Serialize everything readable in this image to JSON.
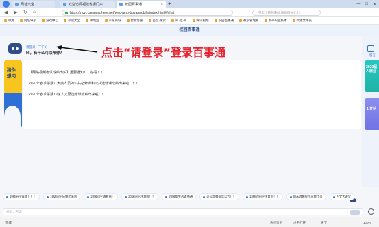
{
  "browser": {
    "tabs": [
      {
        "label": "网址大全",
        "active": false
      },
      {
        "label": "欢迎访问福建省振门户",
        "active": false
      },
      {
        "label": "校园百事通",
        "active": true
      }
    ],
    "url": "https://ncvt.campusphere.net/wec-amp-boya/mobile/index.html#/chat",
    "search_placeholder": "英工出纸越来(化国语精分化出)",
    "bookmarks": [
      "收藏",
      "网址导航",
      "游戏中心",
      "小说大全",
      "邮电监",
      "京东商城",
      "智能客服",
      "百度·搜索",
      "阿·拉·萌",
      "腾讯视频",
      "校园百事通",
      "教学管理系",
      "南平职业技术",
      "新建文件夹"
    ]
  },
  "page": {
    "title": "校园百事通",
    "greeting_link": "请登录，下午好",
    "greeting_question": "Hi，有什么可以帮你？",
    "annotation": "点击“请登录”登录百事通",
    "left_card_title": "猜你想问",
    "notices": [
      "【网络视频考试成绩出炉】重要通知！！必看！！",
      "2020年春季学期八大类人员的公共必修课和公共选修课成绩出来啦！！！",
      "2020年春季学期19级人文限选修课成绩出来啦！！"
    ],
    "right_card_1": "2020届人就业",
    "right_card_2": "1 开始",
    "right_sidebar_label": "留言",
    "chips": [
      "19级开学成绩！！！",
      "19级同学成绩出来啦",
      "20级同学请看看！",
      "20级同学注意啦！！",
      "20级新生选课事通",
      "这些温馨提示公告！！",
      "18级的同学注意啦！！",
      "期末温馨提示成绩出来",
      "人文大讲堂"
    ],
    "input_placeholder": "相问，咨询"
  },
  "status_bar": {
    "left": "完成",
    "items": [
      "热点资讯",
      "点击打开",
      "天下",
      "100%"
    ]
  }
}
